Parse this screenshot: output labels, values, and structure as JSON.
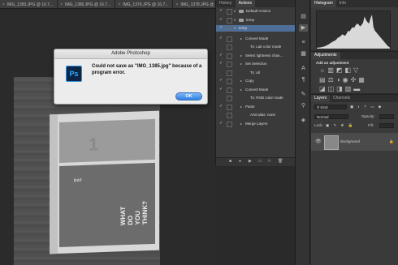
{
  "document_tabs": [
    {
      "label": "IMG_1383.JPG @ 16.7...",
      "active": false
    },
    {
      "label": "IMG_1380.JPG @ 16.7...",
      "active": false
    },
    {
      "label": "IMG_1379.JPG @ 16.7...",
      "active": false
    },
    {
      "label": "IMG_1378.JPG @ 16.7...",
      "active": false
    },
    {
      "label": "IMG_1385.JPG @ 16.7...",
      "active": true
    }
  ],
  "canvas": {
    "photo_text_big": "1",
    "book_vertical_text": "WHAT\nDO\nYOU\nTHINK?",
    "book_small_text": "DAT"
  },
  "dialog": {
    "title": "Adobe Photoshop",
    "app_icon_label": "Ps",
    "message": "Could not save as \"IMG_1385.jpg\" because of a program error.",
    "ok_label": "OK"
  },
  "history_panel": {
    "tabs": [
      {
        "label": "History",
        "active": false
      },
      {
        "label": "Actions",
        "active": true
      }
    ],
    "actions": [
      {
        "label": "Default Actions",
        "level": 0,
        "type": "set",
        "checked": true,
        "selected": false
      },
      {
        "label": "temp",
        "level": 0,
        "type": "set",
        "checked": true,
        "selected": false
      },
      {
        "label": "temp",
        "level": 1,
        "type": "action",
        "checked": true,
        "selected": true
      },
      {
        "label": "Convert Mode",
        "level": 2,
        "type": "step",
        "checked": true,
        "selected": false
      },
      {
        "label": "To: Lab color mode",
        "level": 3,
        "type": "detail",
        "checked": false,
        "selected": false
      },
      {
        "label": "Select lightness chan...",
        "level": 2,
        "type": "step",
        "checked": true,
        "selected": false
      },
      {
        "label": "Set Selection",
        "level": 2,
        "type": "step",
        "checked": true,
        "selected": false
      },
      {
        "label": "To: all",
        "level": 3,
        "type": "detail",
        "checked": false,
        "selected": false
      },
      {
        "label": "Copy",
        "level": 2,
        "type": "step",
        "checked": true,
        "selected": false
      },
      {
        "label": "Convert Mode",
        "level": 2,
        "type": "step",
        "checked": true,
        "selected": false
      },
      {
        "label": "To: RGB color mode",
        "level": 3,
        "type": "detail",
        "checked": false,
        "selected": false
      },
      {
        "label": "Paste",
        "level": 2,
        "type": "step",
        "checked": true,
        "selected": false
      },
      {
        "label": "Anti-alias: none",
        "level": 3,
        "type": "detail",
        "checked": false,
        "selected": false
      },
      {
        "label": "Merge Layers",
        "level": 2,
        "type": "step",
        "checked": true,
        "selected": false
      }
    ]
  },
  "histogram_panel": {
    "tabs": [
      {
        "label": "Histogram",
        "active": true
      },
      {
        "label": "Info",
        "active": false
      }
    ],
    "levels": [
      0.02,
      0.03,
      0.03,
      0.04,
      0.05,
      0.06,
      0.08,
      0.1,
      0.12,
      0.15,
      0.18,
      0.2,
      0.22,
      0.25,
      0.3,
      0.32,
      0.35,
      0.4,
      0.38,
      0.36,
      0.42,
      0.5,
      0.48,
      0.55,
      0.6,
      0.58,
      0.65,
      0.7,
      0.68,
      0.62,
      0.66,
      0.72,
      0.9,
      0.8,
      0.74,
      0.7,
      0.85,
      0.95,
      0.6,
      0.5,
      0.45,
      0.4,
      0.35,
      0.3,
      0.25,
      0.2,
      0.15,
      0.1,
      0.06,
      0.03
    ]
  },
  "adjustments_panel": {
    "title": "Adjustments",
    "subtitle": "Add an adjustment"
  },
  "layers_panel": {
    "tabs": [
      {
        "label": "Layers",
        "active": true
      },
      {
        "label": "Channels",
        "active": false
      }
    ],
    "kind_filter": "Kind",
    "blend_mode": "Normal",
    "opacity_label": "Opacity:",
    "lock_label": "Lock:",
    "fill_label": "Fill:",
    "layer_name": "Background"
  },
  "colors": {
    "accent": "#2f7fe0",
    "selection": "#4f6f98",
    "ps_icon": "#31a8ff"
  }
}
